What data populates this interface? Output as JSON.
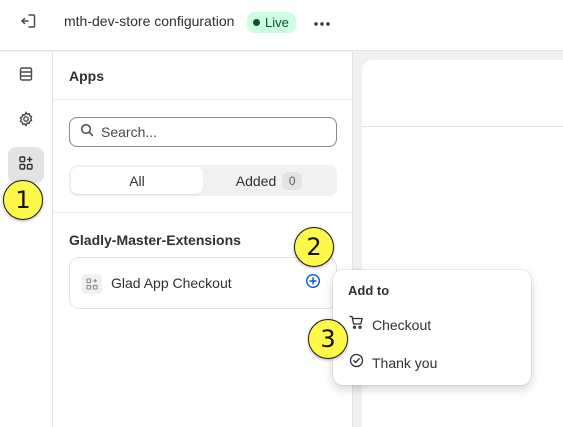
{
  "topbar": {
    "title": "mth-dev-store configuration",
    "status": "Live",
    "exit_icon": "exit-icon",
    "more_icon": "more-horizontal-icon",
    "status_color": "#cdfee1"
  },
  "rail": {
    "items": [
      {
        "icon": "sections-icon",
        "active": false
      },
      {
        "icon": "settings-icon",
        "active": false
      },
      {
        "icon": "apps-icon",
        "active": true
      }
    ]
  },
  "apps_panel": {
    "title": "Apps",
    "search_placeholder": "Search...",
    "tabs": [
      {
        "label": "All",
        "selected": true
      },
      {
        "label": "Added",
        "count": "0",
        "selected": false
      }
    ],
    "groups": [
      {
        "title": "Gladly-Master-Extensions",
        "apps": [
          {
            "name": "Glad App Checkout",
            "icon": "app-blocks-icon",
            "action_icon": "plus-circle-icon"
          }
        ]
      }
    ]
  },
  "popover": {
    "title": "Add to",
    "items": [
      {
        "label": "Checkout",
        "icon": "cart-icon"
      },
      {
        "label": "Thank you",
        "icon": "check-circle-icon"
      }
    ]
  },
  "callouts": [
    "1",
    "2",
    "3"
  ],
  "colors": {
    "accent": "#005bd3",
    "callout": "#fdf84a"
  }
}
